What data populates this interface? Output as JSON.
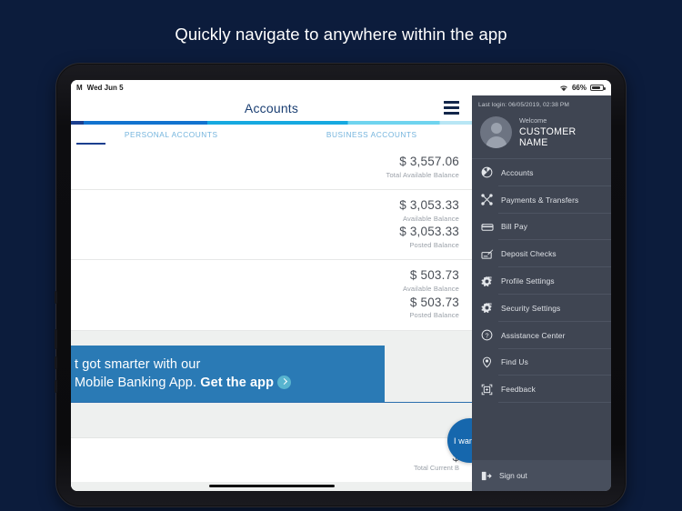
{
  "headline": "Quickly navigate to anywhere within the app",
  "status_bar": {
    "date": "Wed Jun 5",
    "carrier": "M",
    "wifi_icon": "wifi-icon",
    "battery_percent": "66%",
    "battery_level": 66
  },
  "app": {
    "nav": {
      "title": "Accounts",
      "menu_icon": "hamburger-menu-icon"
    },
    "tabs": [
      {
        "label": "PERSONAL ACCOUNTS",
        "active": true
      },
      {
        "label": "BUSINESS ACCOUNTS",
        "active": false
      }
    ],
    "accounts": {
      "summary": {
        "amount": "$ 3,557.06",
        "label": "Total Available Balance"
      },
      "rows": [
        {
          "available_amount": "$ 3,053.33",
          "available_label": "Available Balance",
          "posted_amount": "$ 3,053.33",
          "posted_label": "Posted Balance"
        },
        {
          "available_amount": "$ 503.73",
          "available_label": "Available Balance",
          "posted_amount": "$ 503.73",
          "posted_label": "Posted Balance"
        }
      ],
      "bottom": {
        "amount": "$",
        "label": "Total Current B"
      }
    },
    "promo": {
      "line1": "t got smarter with our",
      "line2_regular": "Mobile Banking App. ",
      "line2_bold": "Get the app",
      "arrow_icon": "chevron-right-circle-icon"
    },
    "fab": {
      "label": "I want to"
    }
  },
  "sidebar": {
    "last_login": "Last login: 06/05/2019, 02:38 PM",
    "welcome_label": "Welcome",
    "customer_name": "CUSTOMER NAME",
    "avatar_icon": "user-avatar-icon",
    "items": [
      {
        "label": "Accounts",
        "icon": "pie-chart-icon"
      },
      {
        "label": "Payments & Transfers",
        "icon": "transfer-arrows-icon"
      },
      {
        "label": "Bill Pay",
        "icon": "credit-card-icon"
      },
      {
        "label": "Deposit Checks",
        "icon": "check-deposit-icon"
      },
      {
        "label": "Profile Settings",
        "icon": "gear-icon"
      },
      {
        "label": "Security Settings",
        "icon": "gear-lock-icon"
      },
      {
        "label": "Assistance Center",
        "icon": "question-circle-icon"
      },
      {
        "label": "Find Us",
        "icon": "location-pin-icon"
      },
      {
        "label": "Feedback",
        "icon": "feedback-frame-icon"
      }
    ],
    "sign_out": {
      "label": "Sign out",
      "icon": "sign-out-icon"
    }
  },
  "colors": {
    "page_background": "#0c1c3c",
    "sidebar_background": "#3f4552",
    "accent_blue": "#1667ad",
    "promo_background": "#2a7ab5",
    "nav_title": "#1b3f73",
    "tab_text": "#74b4dd"
  }
}
